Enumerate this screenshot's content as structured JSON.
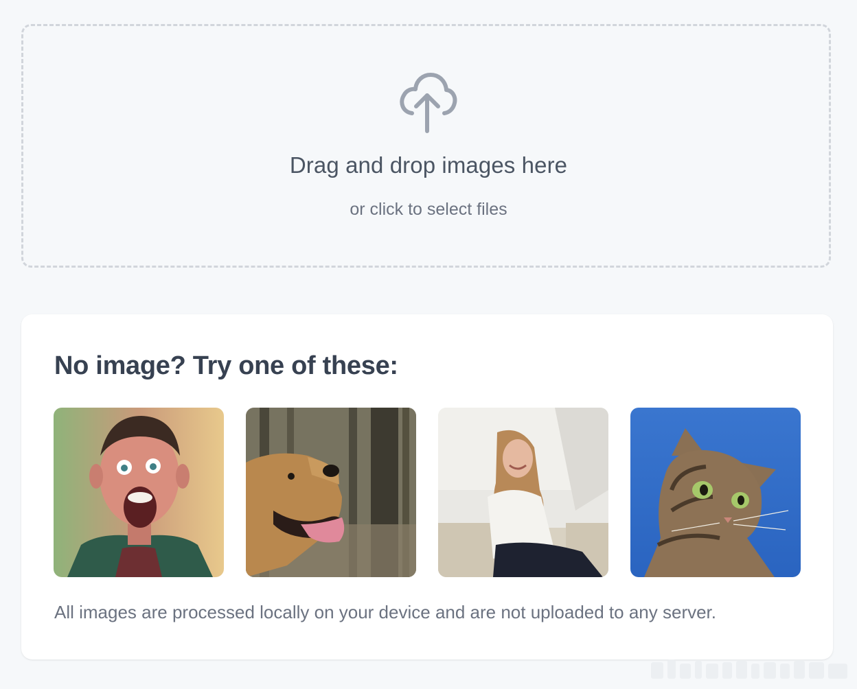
{
  "dropzone": {
    "icon": "cloud-upload-icon",
    "title": "Drag and drop images here",
    "subtitle": "or click to select files"
  },
  "samples": {
    "title": "No image? Try one of these:",
    "images": [
      {
        "icon": "surprised-man-photo"
      },
      {
        "icon": "golden-retriever-photo"
      },
      {
        "icon": "smiling-woman-photo"
      },
      {
        "icon": "tabby-cat-photo"
      }
    ],
    "footnote": "All images are processed locally on your device and are not uploaded to any server."
  },
  "colors": {
    "background": "#f6f8fa",
    "card": "#ffffff",
    "dashed_border": "#d1d5db",
    "icon": "#9ca3af",
    "heading_text": "#374151",
    "body_text": "#6b7280"
  }
}
